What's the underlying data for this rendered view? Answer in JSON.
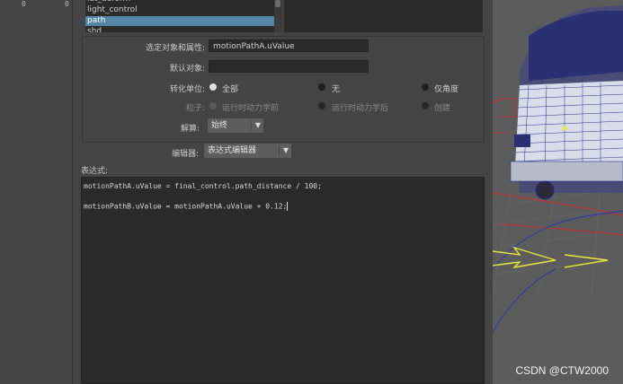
{
  "left_strip": {
    "ticks": [
      "0",
      "0"
    ]
  },
  "node_list": {
    "items": [
      {
        "label": "lat_deform",
        "selected": false
      },
      {
        "label": "light_control",
        "selected": false
      },
      {
        "label": "path",
        "selected": true
      },
      {
        "label": "shd",
        "selected": false
      }
    ]
  },
  "form": {
    "selected_obj_label": "选定对象和属性:",
    "selected_obj_value": "motionPathA.uValue",
    "default_obj_label": "默认对象:",
    "default_obj_value": "",
    "convert_units_label": "转化单位:",
    "convert_units_options": [
      "全部",
      "无",
      "仅角度"
    ],
    "particle_label": "粒子:",
    "particle_options": [
      "运行时动力学前",
      "运行时动力学后",
      "创建"
    ],
    "evaluate_label": "解算:",
    "evaluate_value": "始终",
    "editor_label": "编辑器:",
    "editor_value": "表达式编辑器",
    "expression_label": "表达式:"
  },
  "expression": {
    "lines": [
      "motionPathA.uValue = final_control.path_distance / 100;",
      "motionPathB.uValue = motionPathA.uValue + 0.12;"
    ]
  },
  "watermark": "CSDN @CTW2000",
  "colors": {
    "selection": "#5285a6",
    "wire_blue": "#1f2a8a",
    "wire_red": "#c83030",
    "wire_yellow": "#e6e640"
  }
}
